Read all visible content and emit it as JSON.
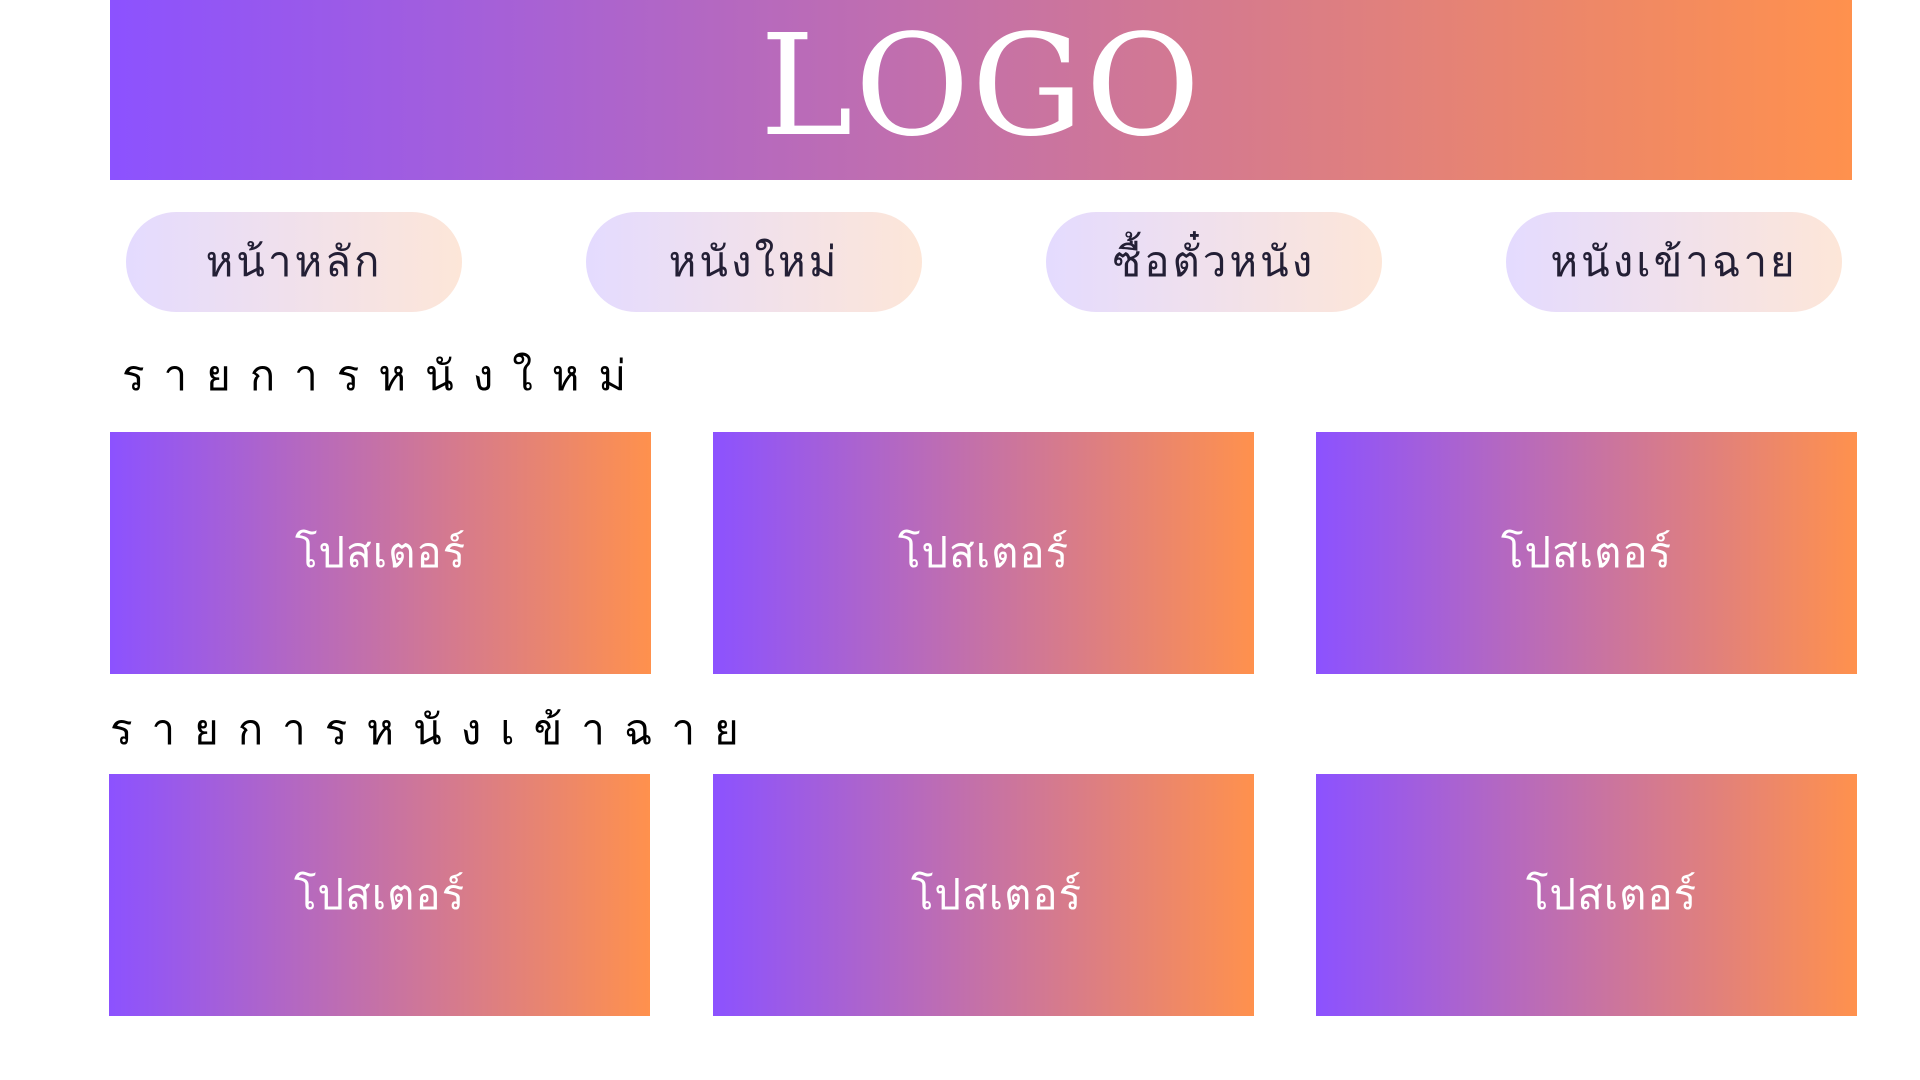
{
  "header": {
    "logo_text": "LOGO"
  },
  "nav": {
    "items": [
      {
        "label": "หน้าหลัก"
      },
      {
        "label": "หนังใหม่"
      },
      {
        "label": "ซื้อตั๋วหนัง"
      },
      {
        "label": "หนังเข้าฉาย"
      }
    ]
  },
  "sections": [
    {
      "title": "รายการหนังใหม่",
      "posters": [
        {
          "label": "โปสเตอร์"
        },
        {
          "label": "โปสเตอร์"
        },
        {
          "label": "โปสเตอร์"
        }
      ]
    },
    {
      "title": "รายการหนังเข้าฉาย",
      "posters": [
        {
          "label": "โปสเตอร์"
        },
        {
          "label": "โปสเตอร์"
        },
        {
          "label": "โปสเตอร์"
        }
      ]
    }
  ],
  "colors": {
    "gradient_start": "#8c52ff",
    "gradient_end": "#ff914d",
    "nav_start": "#e4dbff",
    "nav_end": "#fde6d8"
  }
}
